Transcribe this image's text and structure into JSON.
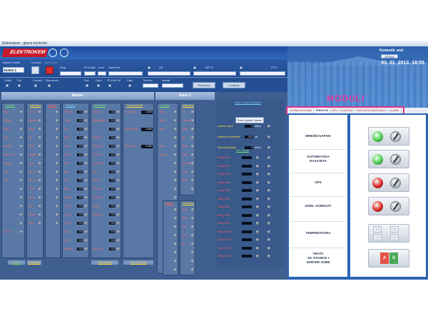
{
  "window": {
    "title": "Elektrokem - glavni kontroler"
  },
  "header": {
    "brand": "ELEKTROKEM",
    "user": "Komunik. and",
    "logout_label": "ODJAVA",
    "datetime": "03. 01. 2013.  18:55",
    "section_title": "MODULI"
  },
  "controls": {
    "master_cubicle_label": "Master Cubicle",
    "master_cubicle_value": "EURO 1",
    "connect_label": "Connect",
    "disconnect_label": "Disconnect",
    "shop_label": "Shop:",
    "rtu_label": "RTU Addr",
    "level_label": "Level",
    "datetime_label": "Date/Time",
    "dr_label": "DR",
    "air_label": "AIR 15",
    "pltu_label": "PLTU",
    "row2": {
      "online": "Online",
      "fail": "Fail",
      "connect": "Connect",
      "disconnect": "Disconnect",
      "run": "Run",
      "open": "Open",
      "rtu_ok": "RTUAdr OK",
      "data": "Data",
      "time_set": "Time set",
      "handle": "Handle"
    },
    "setpoints_label": "Setpoints",
    "controls_label": "Controls"
  },
  "panels": {
    "master_title": "Master",
    "slave_title": "Slave 1",
    "earth_title": "Earth Control Master",
    "earth_button": "Earth update Master",
    "earth_rows": [
      {
        "label": "Earthen Imp./F",
        "value": "0",
        "unit": "kOhm"
      },
      {
        "label": "Maximum Uzemlenje",
        "value": "0.00",
        "unit": "uH"
      },
      {
        "label": "Warning Selvalue",
        "value": "0",
        "unit": "kOhm"
      }
    ],
    "bottom_tabs": [
      "Controls",
      "Indicators",
      "",
      "",
      "Resistances",
      "Time Cont/Fail"
    ]
  },
  "master_columns": [
    {
      "header": "Controls",
      "color": "#6fe06f",
      "items": [
        "Plug",
        "Revise",
        "Revis",
        "Open",
        "Breaker",
        "Earth Top",
        "Isolator",
        "Light",
        "Auto",
        "",
        "",
        "",
        "",
        "",
        "Sar_On"
      ]
    },
    {
      "header": "Indicators",
      "color": "#ffde3a",
      "items": [
        "C/CE",
        "HighVolt",
        "Break",
        "Brk",
        "Earth",
        "Isolator",
        "Tank",
        "Ext_HS",
        "Ext_AC",
        "Load",
        "Alarm",
        "Batt",
        "Sound",
        "Buzz"
      ]
    },
    {
      "header": "Alarms",
      "color": "#ff5b5b",
      "items": []
    },
    {
      "header": "Indicator",
      "color": "#6fd1ff",
      "items": [
        "RTUAdr",
        "Trans",
        "Trip",
        "Earth",
        "Lock",
        "Fault",
        "Pres",
        "Rem",
        "Loc",
        "Hlay",
        "Ready",
        "L1_Err",
        "L2_Err",
        "L3_Err",
        "PriAl",
        "DoAl",
        "HighOn",
        "HighOff"
      ]
    },
    {
      "header": "Battwalue",
      "color": "#6fe06f",
      "items": [
        "Ammer",
        "Windspeed",
        "",
        "BRN_W",
        "BRN_AC",
        "GPS_M",
        "TTL mchsr",
        "Volt",
        "Sub-ves",
        "Vol Fare",
        "DFTemp",
        "Battery",
        "Earthing",
        "",
        "",
        "",
        "Sound_B"
      ]
    },
    {
      "header": "Time Cont/Fail",
      "color": "#ffde3a",
      "items": [
        "Run Hours",
        "",
        "Event Hours",
        "",
        "Batt Hours",
        "",
        "",
        "",
        "",
        "",
        "",
        "",
        "",
        "",
        ""
      ]
    }
  ],
  "slave_columns": [
    {
      "header": "Controls",
      "color": "#6fe06f",
      "items": [
        "Plug",
        "Revis",
        "Open",
        "",
        "Earth",
        "Isolator",
        "",
        "",
        "",
        "",
        "",
        "",
        "",
        "",
        "",
        ""
      ]
    },
    {
      "header": "Indicators",
      "color": "#ffde3a",
      "items": [
        "HV",
        "Corridor",
        "Gate",
        "Brk",
        "Alarm",
        "Tank",
        "M-mode",
        "Timer",
        "Brk-IF"
      ]
    },
    {
      "header": "Alarms",
      "color": "#ff5b5b",
      "items": []
    },
    {
      "header": "Indicators",
      "color": "#ffde3a",
      "items": [
        "TuHL",
        "BrEr",
        "Sub",
        "SFO",
        "Ext"
      ]
    }
  ],
  "soc_relays": {
    "title": "Soc_Relays",
    "rows": [
      "Relay Fail 1",
      "Relay Fail 2",
      "Relay Fail 3",
      "Relay Fail 4",
      "Relay Fail 5",
      "Relay Fail 6",
      "Relay Fail 7",
      "Relay Fail 8",
      "Relay Fail 9",
      "Relay Fail 10",
      "Relay Fail 11",
      "Relay Fail 12",
      "Relay Fail 13"
    ]
  },
  "tabs": [
    "GLOBALNI ALARM",
    "PREGLED",
    "UPS",
    "AGREGAT",
    "RASVJETA SKRETNICA",
    "ALARM"
  ],
  "active_tab": "PREGLED",
  "modules": [
    {
      "name": "MREŽNI NAPON",
      "led": "#49d24a"
    },
    {
      "name": "AUTOMATSKA\nRASVJETA",
      "led": "#49d24a"
    },
    {
      "name": "UPS",
      "led": "#e02222"
    },
    {
      "name": "DIZEL AGREGAT",
      "led": "#e02222"
    },
    {
      "name": "TEMPERATURA",
      "led": ""
    },
    {
      "name": "VRATA\nAK STANICE I\nSERVER SOBE",
      "led": ""
    }
  ],
  "temperature_cells": [
    "T1",
    "T2",
    "T3",
    "T4"
  ],
  "door_buttons": [
    "A",
    "S"
  ],
  "colors": {
    "accent": "#e0308d",
    "bg": "#1d3f74",
    "green": "#49d24a",
    "red": "#e02222"
  }
}
